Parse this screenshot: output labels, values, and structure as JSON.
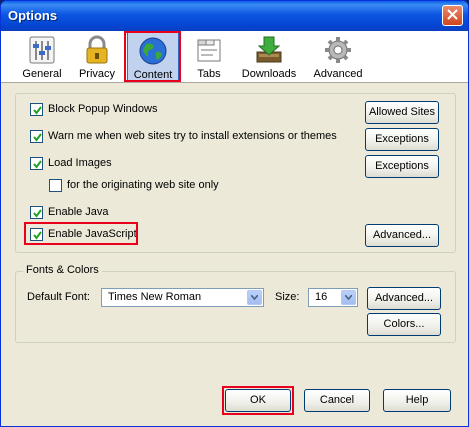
{
  "window": {
    "title": "Options"
  },
  "toolbar": {
    "items": [
      {
        "label": "General",
        "icon": "general-icon"
      },
      {
        "label": "Privacy",
        "icon": "privacy-lock-icon"
      },
      {
        "label": "Content",
        "icon": "content-globe-icon",
        "selected": true
      },
      {
        "label": "Tabs",
        "icon": "tabs-icon"
      },
      {
        "label": "Downloads",
        "icon": "downloads-icon"
      },
      {
        "label": "Advanced",
        "icon": "advanced-gear-icon"
      }
    ]
  },
  "content": {
    "block_popups": {
      "label": "Block Popup Windows",
      "checked": true
    },
    "allowed_sites_button": "Allowed Sites",
    "warn_install": {
      "label": "Warn me when web sites try to install extensions or themes",
      "checked": true
    },
    "exceptions_button_1": "Exceptions",
    "load_images": {
      "label": "Load Images",
      "checked": true
    },
    "exceptions_button_2": "Exceptions",
    "originating_site_only": {
      "label": "for the originating web site only",
      "checked": false
    },
    "enable_java": {
      "label": "Enable Java",
      "checked": true
    },
    "enable_javascript": {
      "label": "Enable JavaScript",
      "checked": true
    },
    "advanced_js_button": "Advanced..."
  },
  "fonts_colors": {
    "legend": "Fonts & Colors",
    "default_font_label": "Default Font:",
    "default_font_value": "Times New Roman",
    "size_label": "Size:",
    "size_value": "16",
    "advanced_button": "Advanced...",
    "colors_button": "Colors..."
  },
  "footer": {
    "ok_button": "OK",
    "cancel_button": "Cancel",
    "help_button": "Help"
  },
  "colors": {
    "highlight_box": "#e8001c",
    "title_bar": "#0b56e2",
    "dialog_bg": "#ece9d8"
  }
}
